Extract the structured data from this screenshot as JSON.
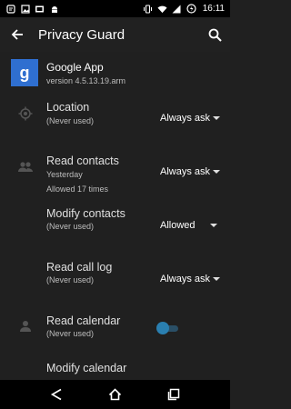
{
  "status_bar": {
    "time": "16:11",
    "left_icons": [
      "notification-icon",
      "image-icon",
      "cast-icon",
      "android-icon"
    ],
    "right_icons": [
      "vibrate-icon",
      "wifi-icon",
      "signal-icon",
      "battery-icon"
    ]
  },
  "toolbar": {
    "title": "Privacy Guard",
    "back_icon": "back-arrow-icon",
    "search_icon": "search-icon"
  },
  "app": {
    "name": "Google App",
    "version": "version 4.5.13.19.arm",
    "icon_letter": "g",
    "icon_color": "#2f6fd0"
  },
  "permissions": [
    {
      "title": "Location",
      "sub1": "(Never used)",
      "sub2": "",
      "value": "Always ask",
      "control": "dropdown",
      "icon": "location-icon"
    },
    {
      "title": "Read contacts",
      "sub1": "Yesterday",
      "sub2": "Allowed 17 times",
      "value": "Always ask",
      "control": "dropdown",
      "icon": "people-icon"
    },
    {
      "title": "Modify contacts",
      "sub1": "(Never used)",
      "sub2": "",
      "value": "Allowed",
      "control": "dropdown",
      "icon": ""
    },
    {
      "title": "Read call log",
      "sub1": "(Never used)",
      "sub2": "",
      "value": "Always ask",
      "control": "dropdown",
      "icon": ""
    },
    {
      "title": "Read calendar",
      "sub1": "(Never used)",
      "sub2": "",
      "value": "",
      "control": "toggle",
      "toggle_on": false,
      "icon": "person-icon"
    },
    {
      "title": "Modify calendar",
      "sub1": "",
      "sub2": "",
      "value": "",
      "control": "none",
      "icon": ""
    }
  ],
  "nav_bar": {
    "back_icon": "nav-back-icon",
    "home_icon": "nav-home-icon",
    "recents_icon": "nav-recents-icon"
  },
  "colors": {
    "background": "#202020",
    "accent": "#2a7fb0"
  }
}
